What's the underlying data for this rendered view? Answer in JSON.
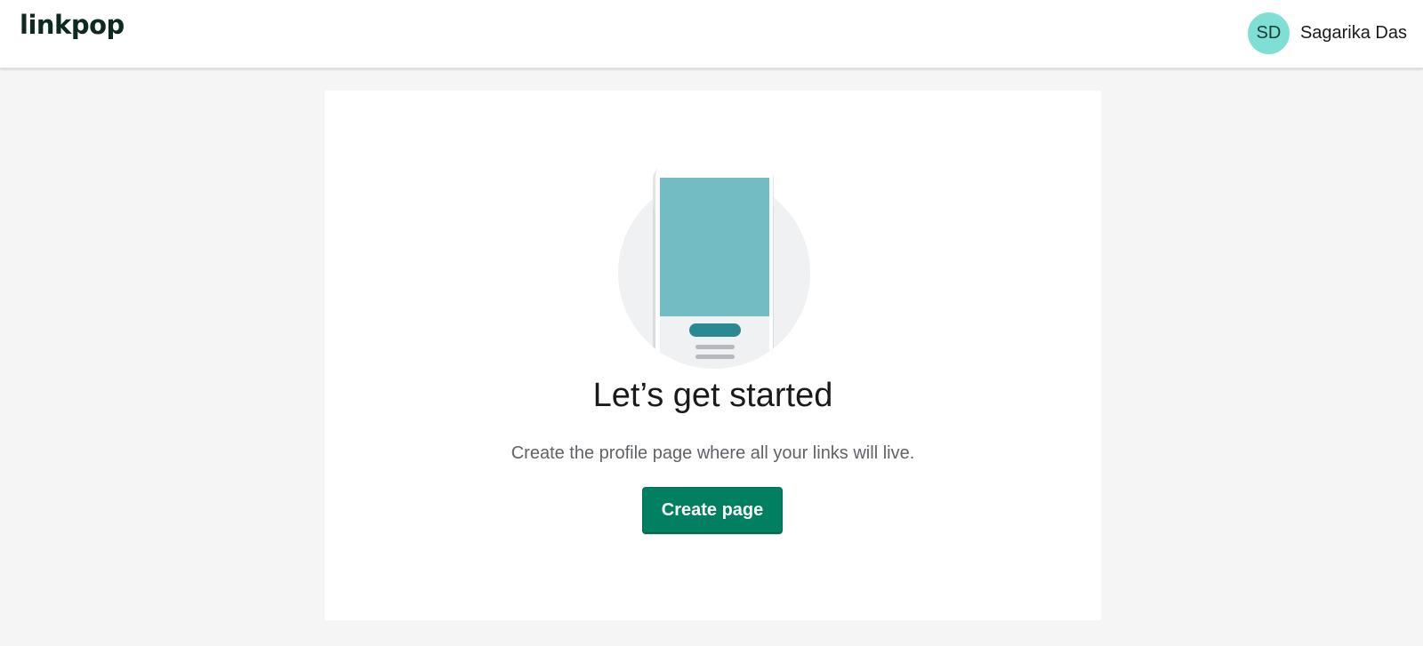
{
  "header": {
    "logo_text": "linkpop",
    "user": {
      "initials": "SD",
      "name": "Sagarika Das"
    }
  },
  "main": {
    "title": "Let’s get started",
    "subtitle": "Create the profile page where all your links will live.",
    "create_button_label": "Create page"
  },
  "colors": {
    "primary_button": "#008060",
    "avatar_bg": "#7fdfd4",
    "phone_screen": "#74bcc3",
    "phone_button": "#2a8a93",
    "page_bg": "#f5f5f5"
  },
  "icons": {
    "illustration": "phone-profile-illustration"
  }
}
